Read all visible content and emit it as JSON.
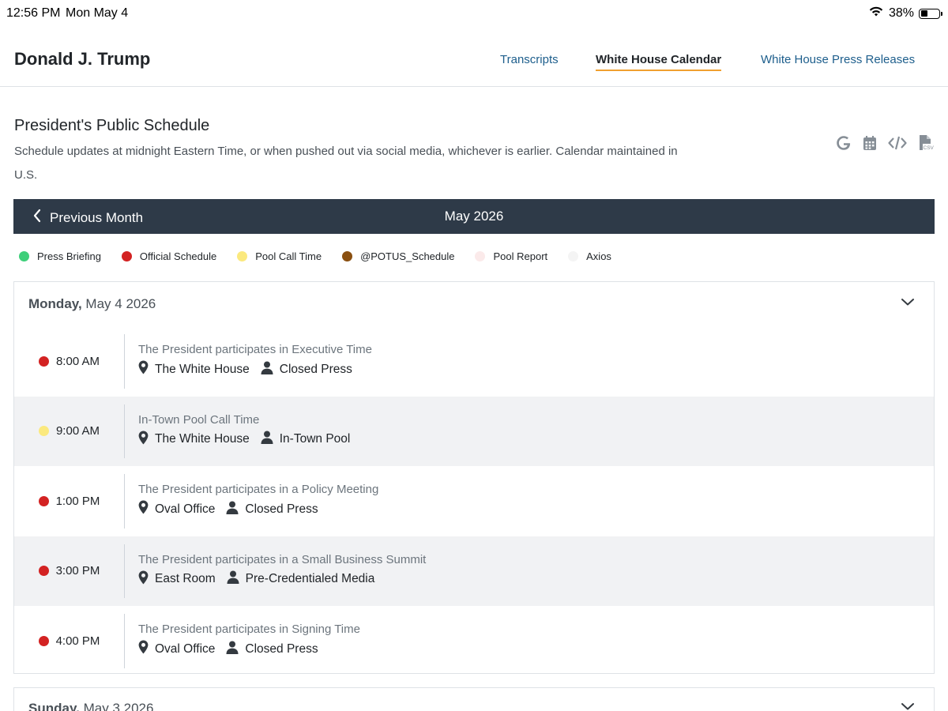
{
  "status_bar": {
    "time": "12:56 PM",
    "date": "Mon May 4",
    "battery": "38%",
    "battery_level": 0.38,
    "icons": [
      "wifi-icon",
      "battery-icon"
    ]
  },
  "header": {
    "brand": "Donald J. Trump",
    "nav": [
      {
        "label": "Transcripts",
        "active": false
      },
      {
        "label": "White House Calendar",
        "active": true
      },
      {
        "label": "White House Press Releases",
        "active": false
      }
    ],
    "active_underline_color": "#f0a030"
  },
  "page": {
    "title": "President's Public Schedule",
    "description": "Schedule updates at midnight Eastern Time, or when pushed out via social media, whichever is earlier. Calendar maintained in U.S.",
    "export_icons": [
      "google-icon",
      "calendar-icon",
      "embed-code-icon",
      "csv-file-icon"
    ]
  },
  "month_bar": {
    "prev_label": "Previous Month",
    "month": "May 2026",
    "background": "#2e3a48"
  },
  "legend": [
    {
      "label": "Press Briefing",
      "color": "#3ecf7a"
    },
    {
      "label": "Official Schedule",
      "color": "#d32222"
    },
    {
      "label": "Pool Call Time",
      "color": "#fbe97e"
    },
    {
      "label": "@POTUS_Schedule",
      "color": "#8a4f10"
    },
    {
      "label": "Pool Report",
      "color": "#fbeaea"
    },
    {
      "label": "Axios",
      "color": "#f4f4f4"
    }
  ],
  "days": [
    {
      "weekday": "Monday,",
      "date": "May 4 2026",
      "events": [
        {
          "time": "8:00 AM",
          "color": "#d32222",
          "title": "The President participates in Executive Time",
          "location": "The White House",
          "coverage": "Closed Press"
        },
        {
          "time": "9:00 AM",
          "color": "#fbe97e",
          "title": "In-Town Pool Call Time",
          "location": "The White House",
          "coverage": "In-Town Pool"
        },
        {
          "time": "1:00 PM",
          "color": "#d32222",
          "title": "The President participates in a Policy Meeting",
          "location": "Oval Office",
          "coverage": "Closed Press"
        },
        {
          "time": "3:00 PM",
          "color": "#d32222",
          "title": "The President participates in a Small Business Summit",
          "location": "East Room",
          "coverage": "Pre-Credentialed Media"
        },
        {
          "time": "4:00 PM",
          "color": "#d32222",
          "title": "The President participates in Signing Time",
          "location": "Oval Office",
          "coverage": "Closed Press"
        }
      ]
    },
    {
      "weekday": "Sunday,",
      "date": "May 3 2026",
      "events": []
    }
  ]
}
